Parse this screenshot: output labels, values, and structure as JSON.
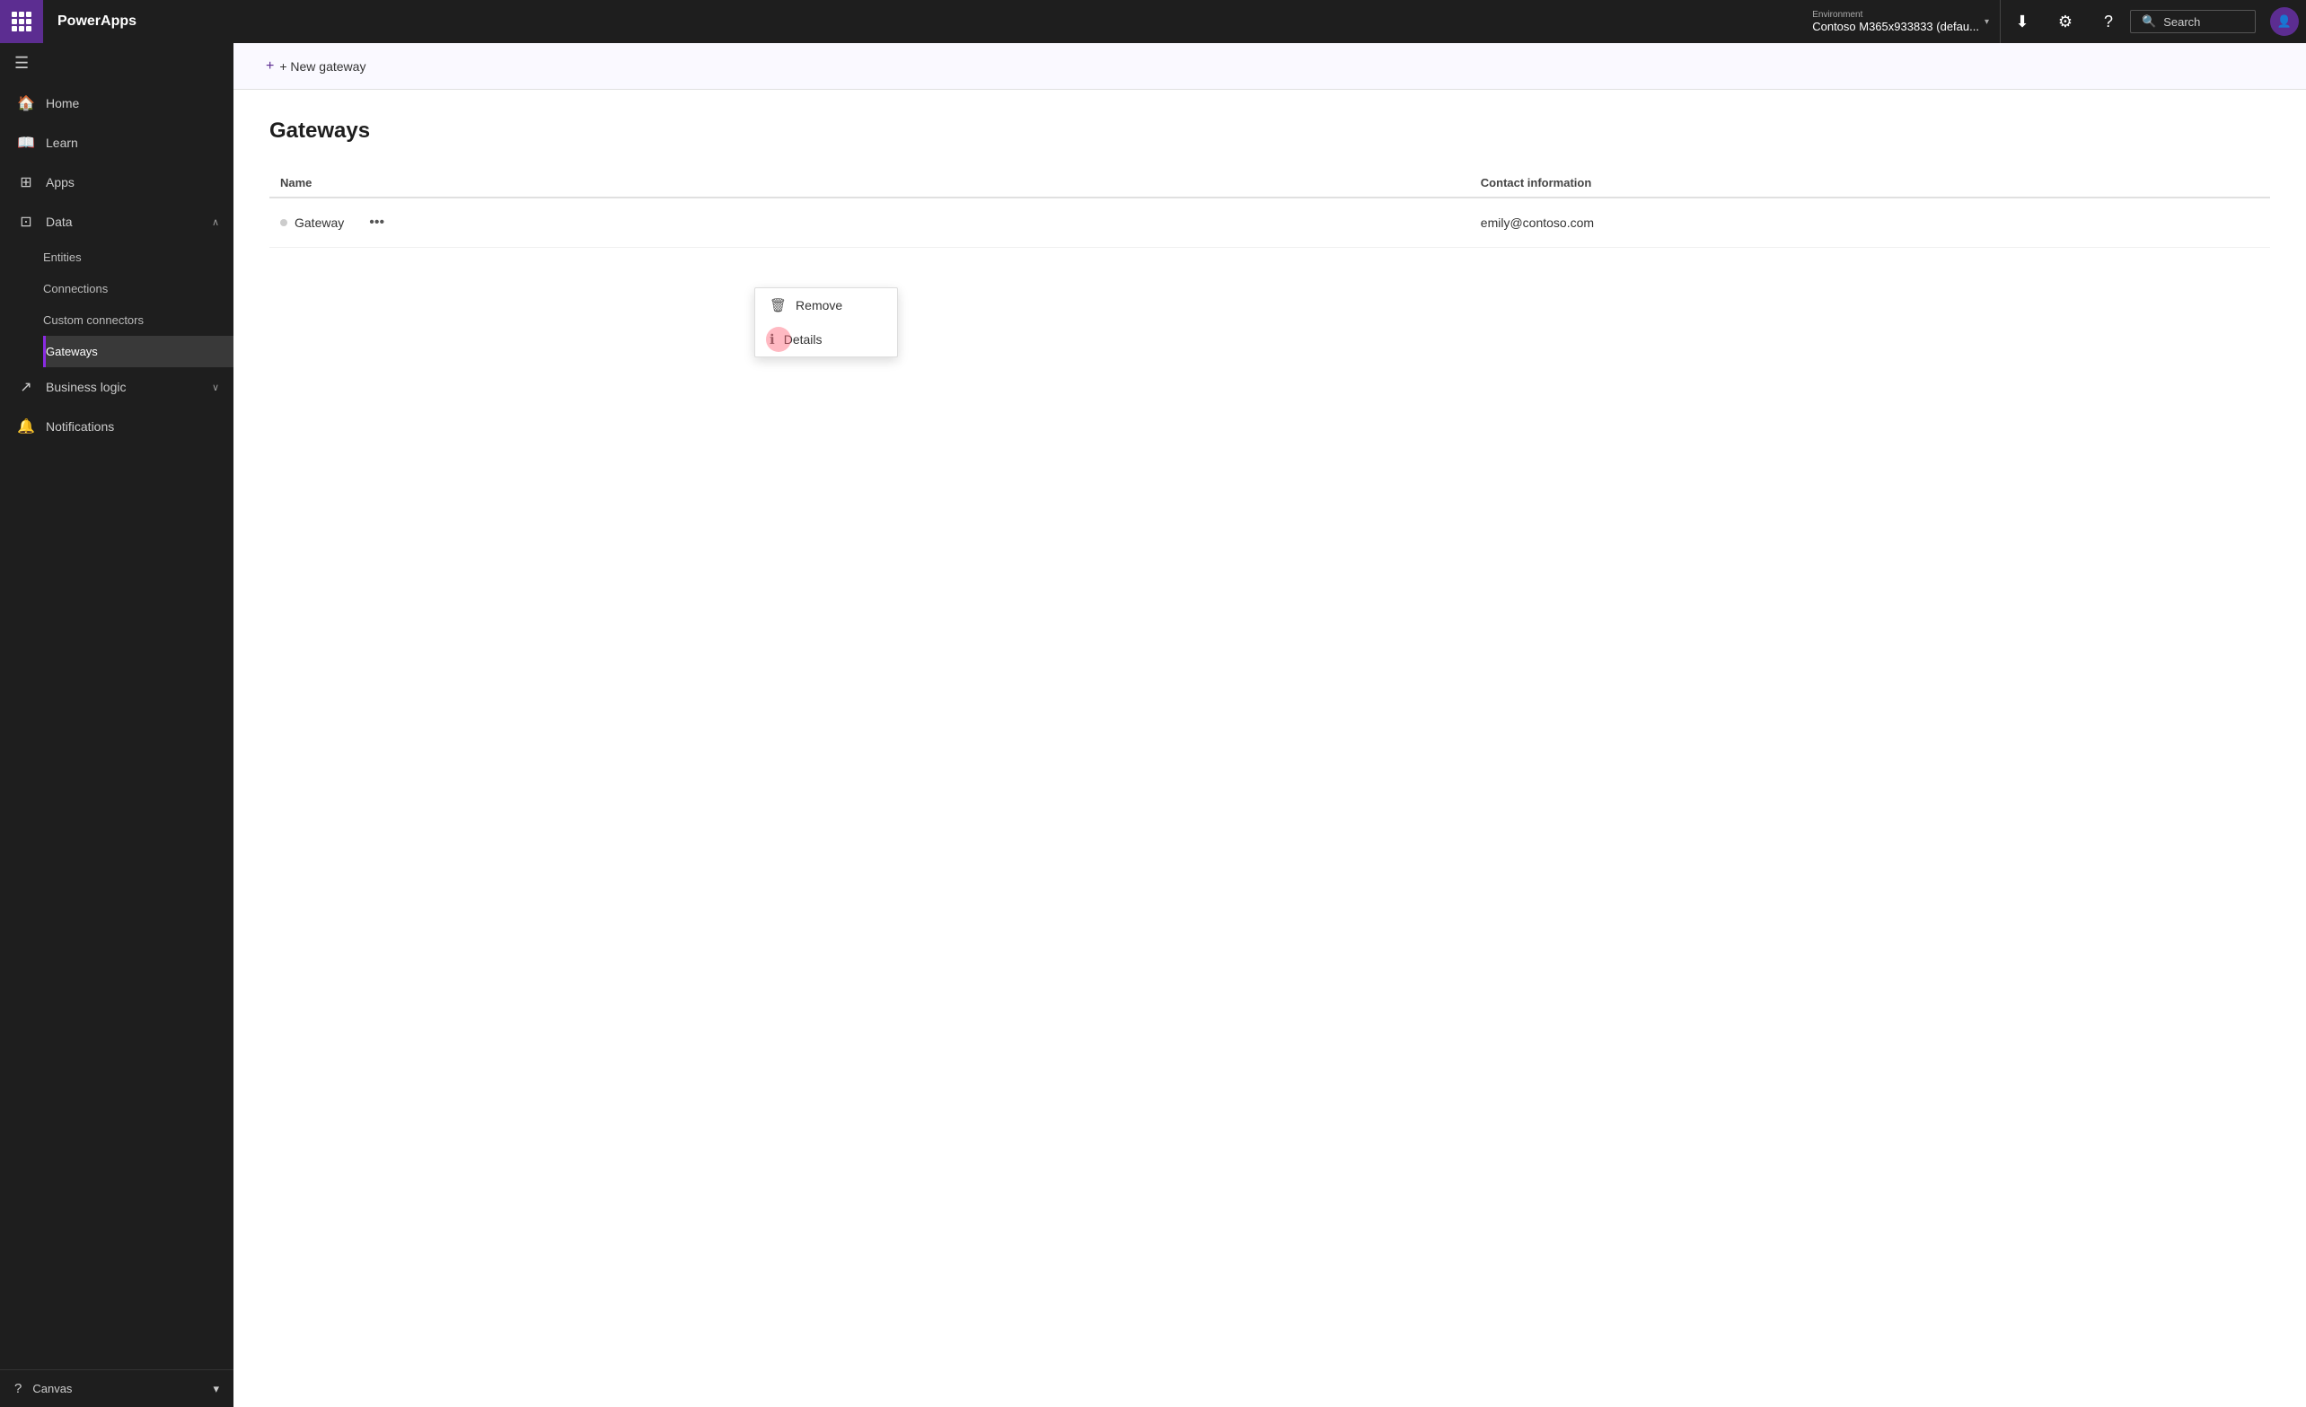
{
  "app": {
    "name": "PowerApps"
  },
  "topbar": {
    "environment_label": "Environment",
    "environment_name": "Contoso M365x933833 (defau...",
    "search_placeholder": "Search",
    "download_icon": "⬇",
    "settings_icon": "⚙",
    "help_icon": "?",
    "avatar_initials": ""
  },
  "sidebar": {
    "collapse_icon": "☰",
    "items": [
      {
        "id": "home",
        "label": "Home",
        "icon": "🏠",
        "active": false
      },
      {
        "id": "learn",
        "label": "Learn",
        "icon": "📖",
        "active": false
      },
      {
        "id": "apps",
        "label": "Apps",
        "icon": "⊞",
        "active": false
      },
      {
        "id": "data",
        "label": "Data",
        "icon": "⊡",
        "active": false,
        "expanded": true
      },
      {
        "id": "business-logic",
        "label": "Business logic",
        "icon": "↗",
        "active": false,
        "expanded": false
      },
      {
        "id": "notifications",
        "label": "Notifications",
        "icon": "🔔",
        "active": false
      }
    ],
    "data_sub_items": [
      {
        "id": "entities",
        "label": "Entities"
      },
      {
        "id": "connections",
        "label": "Connections"
      },
      {
        "id": "custom-connectors",
        "label": "Custom connectors"
      },
      {
        "id": "gateways",
        "label": "Gateways"
      }
    ],
    "footer": {
      "canvas_label": "Canvas",
      "help_icon": "?",
      "chevron": "▾"
    }
  },
  "toolbar": {
    "new_gateway_label": "+ New gateway"
  },
  "page": {
    "title": "Gateways",
    "table": {
      "col_name": "Name",
      "col_contact": "Contact information",
      "rows": [
        {
          "name": "Gateway",
          "contact": "emily@contoso.com"
        }
      ]
    }
  },
  "context_menu": {
    "items": [
      {
        "id": "remove",
        "label": "Remove",
        "icon": "🗑"
      },
      {
        "id": "details",
        "label": "Details",
        "icon": "ℹ",
        "highlighted": true
      }
    ]
  }
}
